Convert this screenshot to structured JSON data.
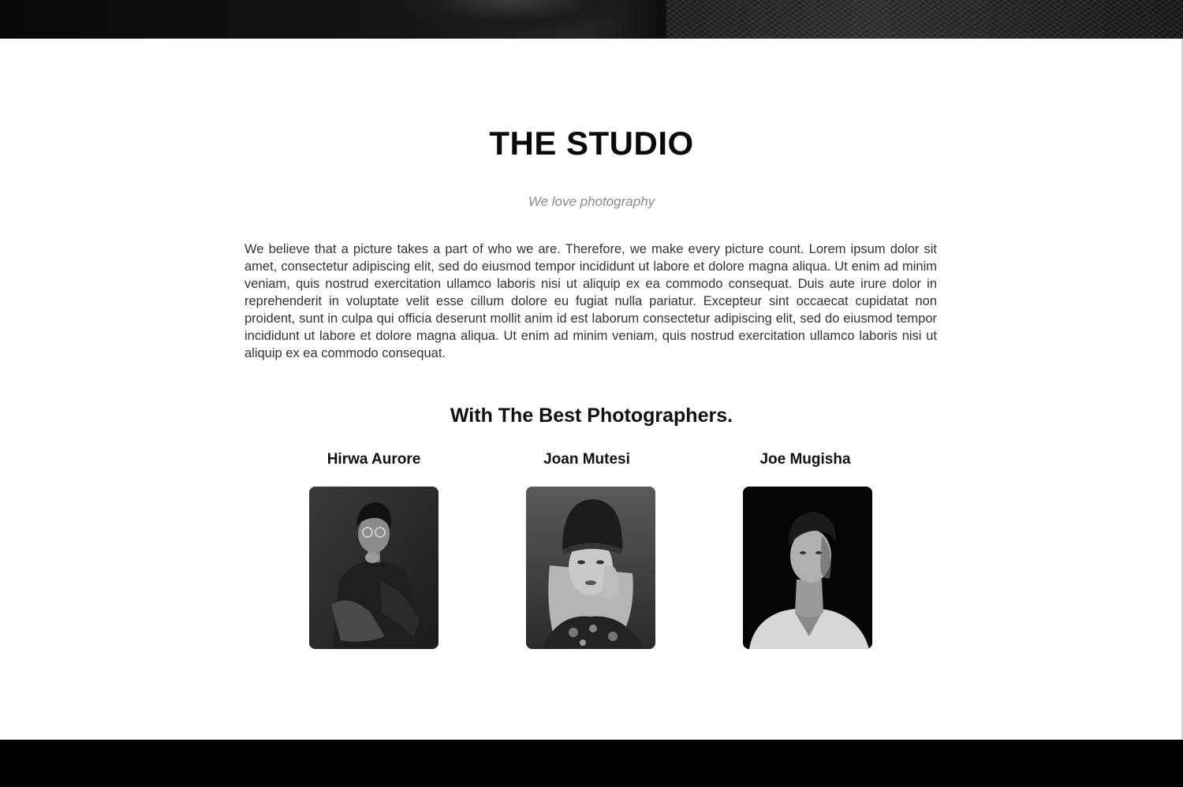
{
  "studio": {
    "title": "THE STUDIO",
    "tagline": "We love photography",
    "description": "We believe that a picture takes a part of who we are. Therefore, we make every picture count. Lorem ipsum dolor sit amet, consectetur adipiscing elit, sed do eiusmod tempor incididunt ut labore et dolore magna aliqua. Ut enim ad minim veniam, quis nostrud exercitation ullamco laboris nisi ut aliquip ex ea commodo consequat. Duis aute irure dolor in reprehenderit in voluptate velit esse cillum dolore eu fugiat nulla pariatur. Excepteur sint occaecat cupidatat non proident, sunt in culpa qui officia deserunt mollit anim id est laborum consectetur adipiscing elit, sed do eiusmod tempor incididunt ut labore et dolore magna aliqua. Ut enim ad minim veniam, quis nostrud exercitation ullamco laboris nisi ut aliquip ex ea commodo consequat."
  },
  "team": {
    "heading": "With The Best Photographers.",
    "members": [
      {
        "name": "Hirwa Aurore"
      },
      {
        "name": "Joan Mutesi"
      },
      {
        "name": "Joe Mugisha"
      }
    ]
  }
}
